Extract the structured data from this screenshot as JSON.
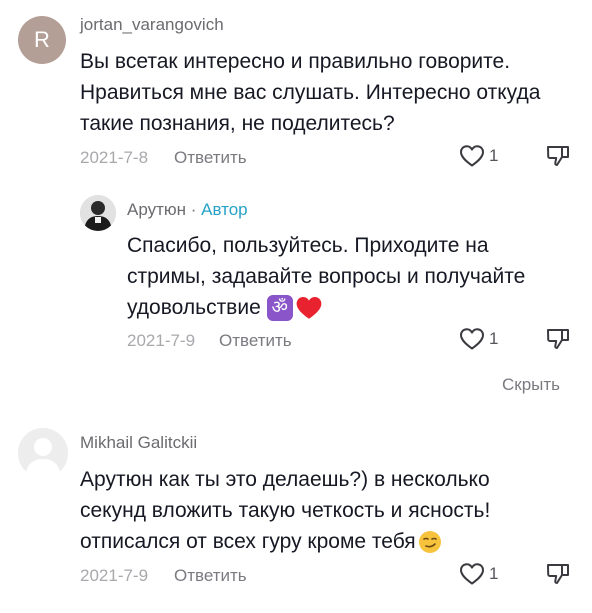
{
  "comments": [
    {
      "avatar_letter": "R",
      "avatar_color": "#b49f96",
      "username": "jortan_varangovich",
      "lines": [
        "Вы всетак интересно и правильно говорите.",
        "Нравиться мне вас слушать. Интересно откуда",
        "такие познания, не поделитесь?"
      ],
      "date": "2021-7-8",
      "reply_label": "Ответить",
      "likes": "1"
    },
    {
      "username": "Арутюн",
      "separator": " · ",
      "author_label": "Автор",
      "lines": [
        "Спасибо, пользуйтесь. Приходите на",
        "стримы, задавайте вопросы и получайте",
        "удовольствие"
      ],
      "emoji": [
        "om-emoji",
        "red-heart-emoji"
      ],
      "date": "2021-7-9",
      "reply_label": "Ответить",
      "likes": "1"
    },
    {
      "username": "Mikhail Galitckii",
      "lines": [
        "Арутюн как ты это делаешь?) в несколько",
        "секунд вложить такую четкость и ясность!",
        "отписался от всех гуру кроме тебя"
      ],
      "emoji": [
        "smirking-face-emoji"
      ],
      "date": "2021-7-9",
      "reply_label": "Ответить",
      "likes": "1"
    }
  ],
  "hide_label": "Скрыть",
  "colors": {
    "author_accent": "#27a2c7",
    "heart_red": "#e8232f",
    "om_purple": "#8a55c9"
  }
}
